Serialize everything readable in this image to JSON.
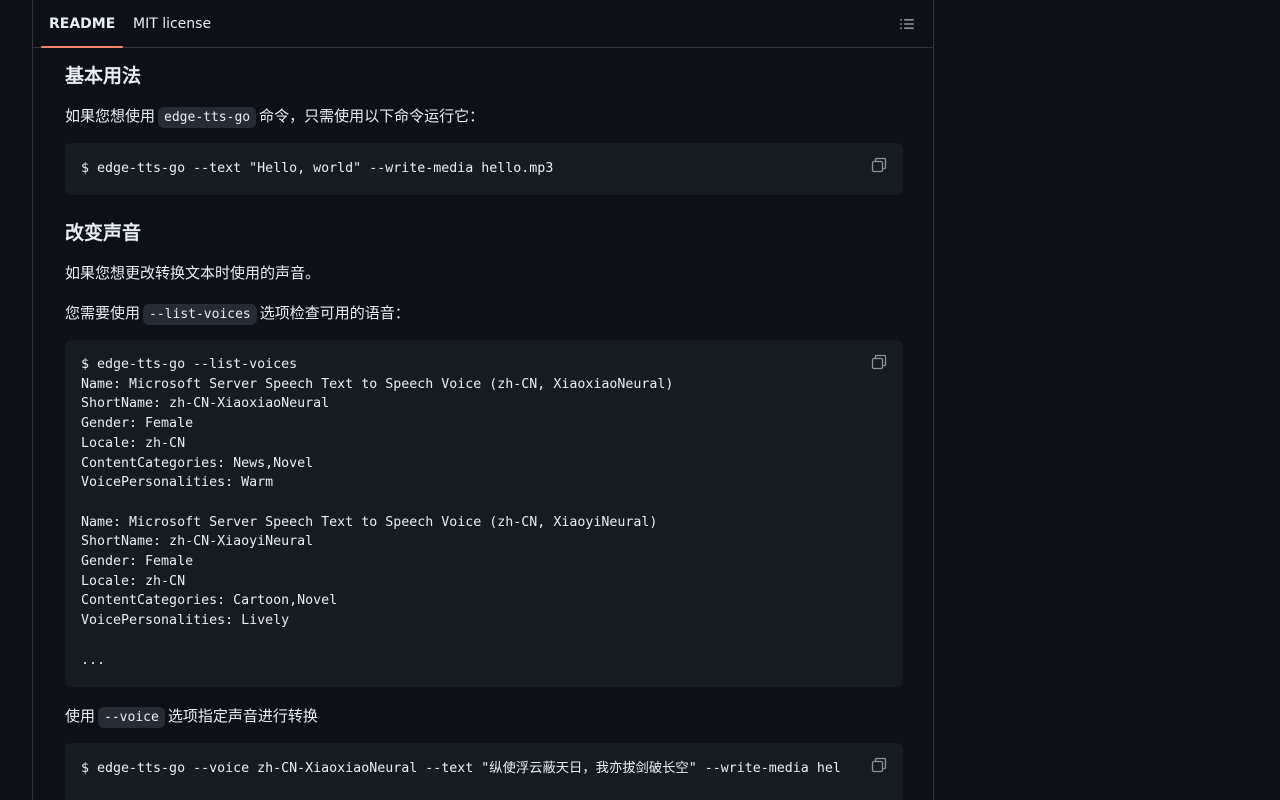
{
  "tabs": {
    "readme_label": "README",
    "license_label": "MIT license"
  },
  "icons": {
    "outline": "list-unordered-icon",
    "copy": "copy-icon"
  },
  "colors": {
    "background": "#0d1117",
    "code_background": "#161b22",
    "tab_underline": "#f78166",
    "text": "#e6edf3",
    "muted": "#8b949e",
    "border": "#30363d"
  },
  "sections": {
    "basic_usage": {
      "heading": "基本用法",
      "para_prefix": "如果您想使用",
      "para_code": "edge-tts-go",
      "para_suffix": "命令，只需使用以下命令运行它：",
      "code": "$ edge-tts-go --text \"Hello, world\" --write-media hello.mp3"
    },
    "change_voice": {
      "heading": "改变声音",
      "para1": "如果您想更改转换文本时使用的声音。",
      "para2_prefix": "您需要使用",
      "para2_code": "--list-voices",
      "para2_suffix": "选项检查可用的语音：",
      "code": "$ edge-tts-go --list-voices\nName: Microsoft Server Speech Text to Speech Voice (zh-CN, XiaoxiaoNeural)\nShortName: zh-CN-XiaoxiaoNeural\nGender: Female\nLocale: zh-CN\nContentCategories: News,Novel\nVoicePersonalities: Warm\n\nName: Microsoft Server Speech Text to Speech Voice (zh-CN, XiaoyiNeural)\nShortName: zh-CN-XiaoyiNeural\nGender: Female\nLocale: zh-CN\nContentCategories: Cartoon,Novel\nVoicePersonalities: Lively\n\n...",
      "para3_prefix": "使用",
      "para3_code": "--voice",
      "para3_suffix": "选项指定声音进行转换",
      "code2": "$ edge-tts-go --voice zh-CN-XiaoxiaoNeural --text \"纵使浮云蔽天日，我亦拔剑破长空\" --write-media hel"
    }
  }
}
